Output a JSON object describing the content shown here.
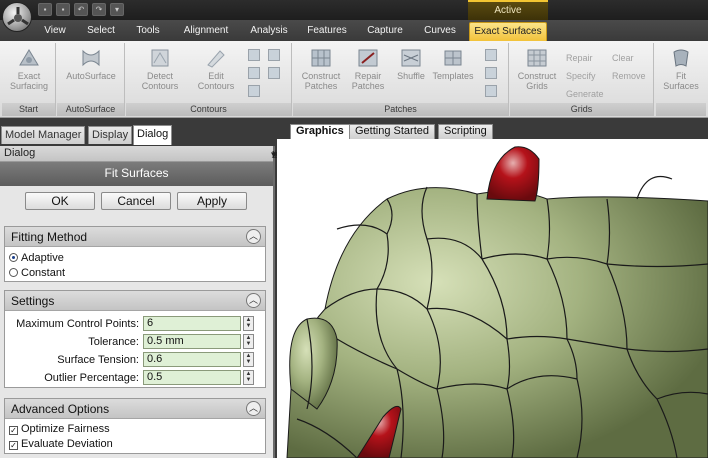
{
  "titlebar": {
    "context_tab_label": "Active"
  },
  "ribbon_tabs": [
    "View",
    "Select",
    "Tools",
    "Alignment",
    "Analysis",
    "Features",
    "Capture",
    "Curves",
    "Exact Surfaces"
  ],
  "ribbon": {
    "groups": {
      "start": "Start",
      "autosurface": "AutoSurface",
      "contours": "Contours",
      "patches": "Patches",
      "grids": "Grids"
    },
    "buttons": {
      "exact_surfacing": "Exact Surfacing",
      "autosurface": "AutoSurface",
      "detect_contours": "Detect Contours",
      "edit_contours": "Edit Contours",
      "construct_patches": "Construct Patches",
      "repair_patches": "Repair Patches",
      "shuffle": "Shuffle",
      "templates": "Templates",
      "construct_grids": "Construct Grids",
      "repair": "Repair",
      "specify": "Specify",
      "generate": "Generate",
      "clear": "Clear",
      "remove": "Remove",
      "fit_surfaces": "Fit Surfaces"
    }
  },
  "panel_tabs": [
    "Model Manager",
    "Display",
    "Dialog"
  ],
  "panel": {
    "header": "Dialog",
    "dialog_title": "Fit Surfaces",
    "buttons": {
      "ok": "OK",
      "cancel": "Cancel",
      "apply": "Apply"
    },
    "fitting_method": {
      "title": "Fitting Method",
      "options": [
        "Adaptive",
        "Constant"
      ],
      "selected": "Adaptive"
    },
    "settings": {
      "title": "Settings",
      "fields": [
        {
          "label": "Maximum Control Points:",
          "value": "6"
        },
        {
          "label": "Tolerance:",
          "value": "0.5 mm"
        },
        {
          "label": "Surface Tension:",
          "value": "0.6"
        },
        {
          "label": "Outlier Percentage:",
          "value": "0.5"
        }
      ]
    },
    "advanced": {
      "title": "Advanced Options",
      "options": [
        {
          "label": "Optimize Fairness",
          "checked": true
        },
        {
          "label": "Evaluate Deviation",
          "checked": true
        }
      ]
    }
  },
  "graphics_tabs": [
    "Graphics",
    "Getting Started",
    "Scripting"
  ],
  "colors": {
    "accent": "#f2c23a",
    "surface": "#9fae7c",
    "highlight_patch": "#c0141c",
    "input_bg": "#dff0d6"
  }
}
